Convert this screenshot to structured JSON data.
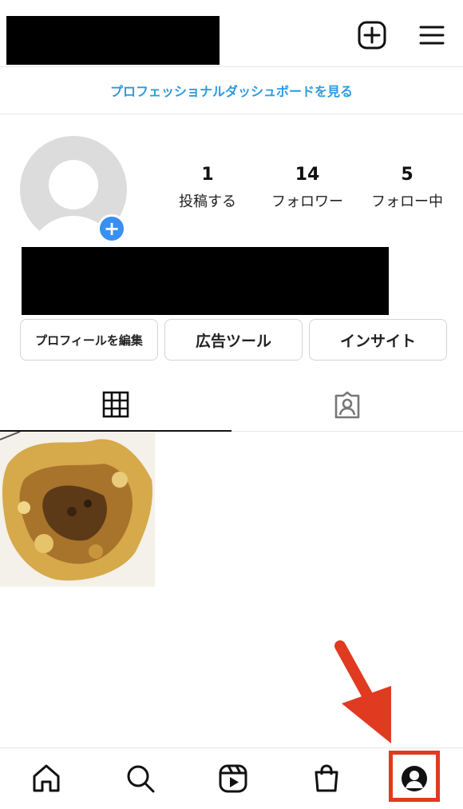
{
  "header": {
    "add_icon": "plus-square-icon",
    "menu_icon": "hamburger-menu-icon"
  },
  "dashboard_link": "プロフェッショナルダッシュボードを見る",
  "profile": {
    "stats": {
      "posts": {
        "value": "1",
        "label": "投稿する"
      },
      "followers": {
        "value": "14",
        "label": "フォロワー"
      },
      "following": {
        "value": "5",
        "label": "フォロー中"
      }
    },
    "add_avatar": "+"
  },
  "buttons": {
    "edit_profile": "プロフィールを編集",
    "ad_tools": "広告ツール",
    "insights": "インサイト"
  },
  "tabs": {
    "grid_icon": "grid-icon",
    "tagged_icon": "tagged-person-icon"
  },
  "nav": {
    "items": [
      "home-icon",
      "search-icon",
      "reels-icon",
      "shop-icon",
      "profile-icon"
    ]
  },
  "colors": {
    "link": "#2a9be0",
    "add_avatar": "#3a8ff2",
    "annotation": "#e03a21"
  }
}
